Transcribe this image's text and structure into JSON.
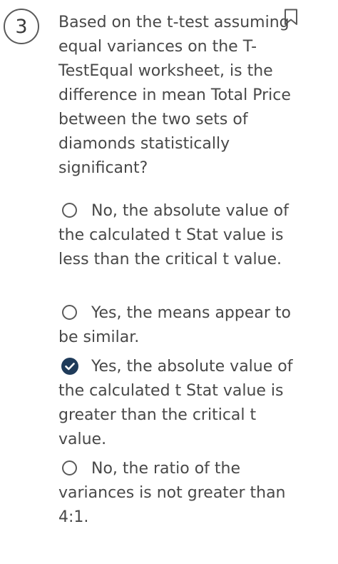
{
  "question": {
    "number": "3",
    "text": "Based on the t-test assuming equal variances on the T-TestEqual worksheet, is the difference in mean Total Price between the two sets of diamonds statistically significant?",
    "bookmark_icon": "bookmark-icon"
  },
  "options": [
    {
      "label": "No, the absolute value of the calculated t Stat value is less than the critical t value.",
      "selected": false
    },
    {
      "label": "Yes, the means appear to be similar.",
      "selected": false
    },
    {
      "label": "Yes, the absolute value of the calculated t Stat value is greater than the critical t value.",
      "selected": true
    },
    {
      "label": "No, the ratio of the variances is not greater than 4:1.",
      "selected": false
    }
  ],
  "colors": {
    "selected_radio": "#1f3b5a",
    "text": "#484848",
    "border": "#5a5a5a"
  }
}
